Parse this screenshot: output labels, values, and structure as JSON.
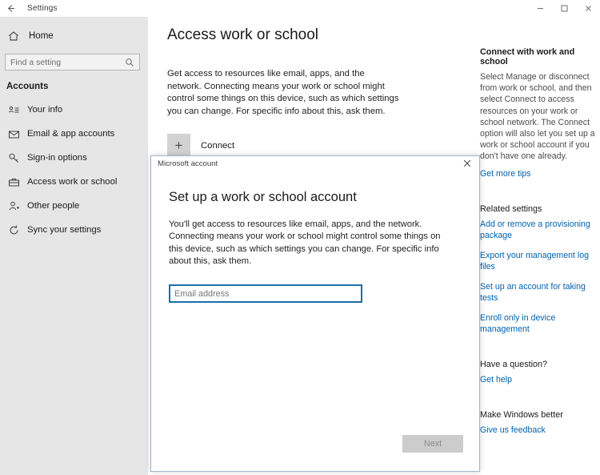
{
  "window": {
    "title": "Settings",
    "back_icon": "back-arrow-icon",
    "minimize_label": "–",
    "maximize_label": "□",
    "close_label": "✕"
  },
  "sidebar": {
    "home": {
      "label": "Home",
      "icon": "home-icon"
    },
    "search": {
      "placeholder": "Find a setting",
      "value": "",
      "icon": "search-icon"
    },
    "group_title": "Accounts",
    "items": [
      {
        "label": "Your info",
        "icon": "contact-card-icon",
        "selected": false
      },
      {
        "label": "Email & app accounts",
        "icon": "envelope-icon",
        "selected": false
      },
      {
        "label": "Sign-in options",
        "icon": "key-icon",
        "selected": false
      },
      {
        "label": "Access work or school",
        "icon": "briefcase-icon",
        "selected": false
      },
      {
        "label": "Other people",
        "icon": "person-add-icon",
        "selected": false
      },
      {
        "label": "Sync your settings",
        "icon": "sync-icon",
        "selected": false
      }
    ]
  },
  "main": {
    "title": "Access work or school",
    "description": "Get access to resources like email, apps, and the network. Connecting means your work or school might control some things on this device, such as which settings you can change. For specific info about this, ask them.",
    "connect": {
      "label": "Connect",
      "icon": "plus-icon",
      "plus": "+"
    }
  },
  "right_panel": {
    "connect_head": "Connect with work and school",
    "connect_text": "Select Manage or disconnect from work or school, and then select Connect to access resources on your work or school network. The Connect option will also let you set up a work or school account if you don't have one already.",
    "get_more_tips": "Get more tips",
    "related_head": "Related settings",
    "related_links": [
      "Add or remove a provisioning package",
      "Export your management log files",
      "Set up an account for taking tests",
      "Enroll only in device management"
    ],
    "question_head": "Have a question?",
    "get_help": "Get help",
    "better_head": "Make Windows better",
    "feedback": "Give us feedback"
  },
  "dialog": {
    "title": "Microsoft account",
    "close_label": "✕",
    "heading": "Set up a work or school account",
    "body": "You'll get access to resources like email, apps, and the network. Connecting means your work or school might control some things on this device, such as which settings you can change. For specific info about this, ask them.",
    "email": {
      "placeholder": "Email address",
      "value": ""
    },
    "next_label": "Next"
  },
  "colors": {
    "sidebar_bg": "#e6e6e6",
    "link": "#0063b1",
    "focus_border": "#1d6fa5",
    "disabled_button": "#cccccc"
  }
}
